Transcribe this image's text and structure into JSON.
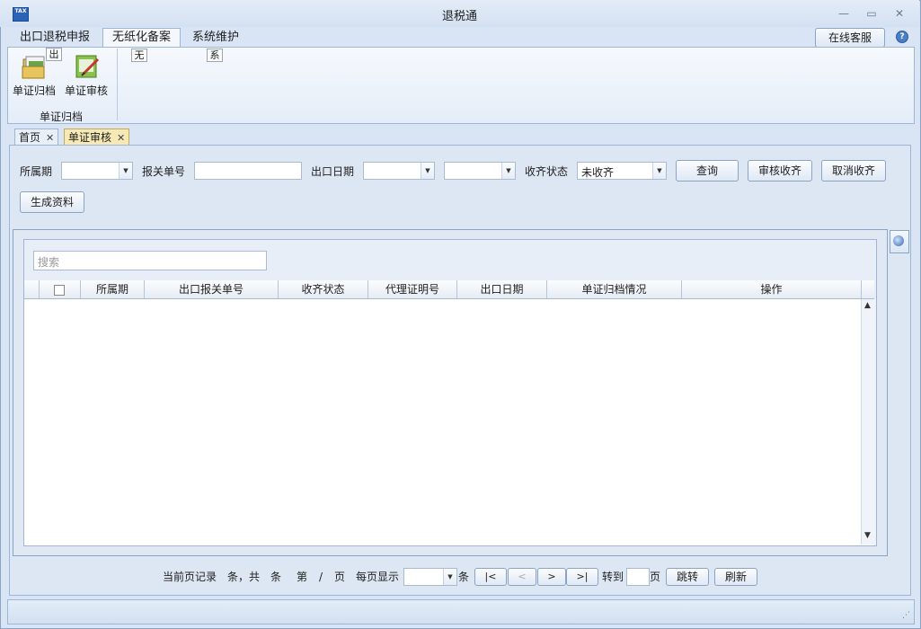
{
  "window": {
    "title": "退税通",
    "app_icon_text": "TAX",
    "minimize": "▭",
    "restore": "▭",
    "close": "✕"
  },
  "menu_tabs": [
    {
      "label": "出口退税申报"
    },
    {
      "label": "无纸化备案"
    },
    {
      "label": "系统维护"
    }
  ],
  "keytips": {
    "tab1": "出",
    "tab2": "无",
    "tab3": "系"
  },
  "online_service": "在线客服",
  "help": "?",
  "ribbon": {
    "buttons": [
      {
        "label": "单证归档"
      },
      {
        "label": "单证审核"
      }
    ],
    "group_label": "单证归档"
  },
  "doc_tabs": [
    {
      "label": "首页",
      "close": "✕"
    },
    {
      "label": "单证审核",
      "close": "✕"
    }
  ],
  "filters": {
    "period_label": "所属期",
    "period_value": "",
    "customs_no_label": "报关单号",
    "customs_no_value": "",
    "export_date_label": "出口日期",
    "export_date_from": "",
    "export_date_to": "",
    "status_label": "收齐状态",
    "status_value": "未收齐",
    "query_btn": "查询",
    "audit_btn": "审核收齐",
    "cancel_btn": "取消收齐",
    "generate_btn": "生成资料"
  },
  "search": {
    "placeholder": "搜索"
  },
  "table": {
    "columns": [
      "所属期",
      "出口报关单号",
      "收齐状态",
      "代理证明号",
      "出口日期",
      "单证归档情况",
      "操作"
    ],
    "rows": []
  },
  "pager": {
    "text1": "当前页记录",
    "text2": "条，共",
    "text3": "条",
    "text4": "第",
    "text5": "/",
    "text6": "页",
    "per_page_label": "每页显示",
    "per_page_unit": "条",
    "first": "|<",
    "prev": "<",
    "next": ">",
    "last": ">|",
    "goto_label": "转到",
    "goto_unit": "页",
    "jump_btn": "跳转",
    "refresh_btn": "刷新"
  }
}
